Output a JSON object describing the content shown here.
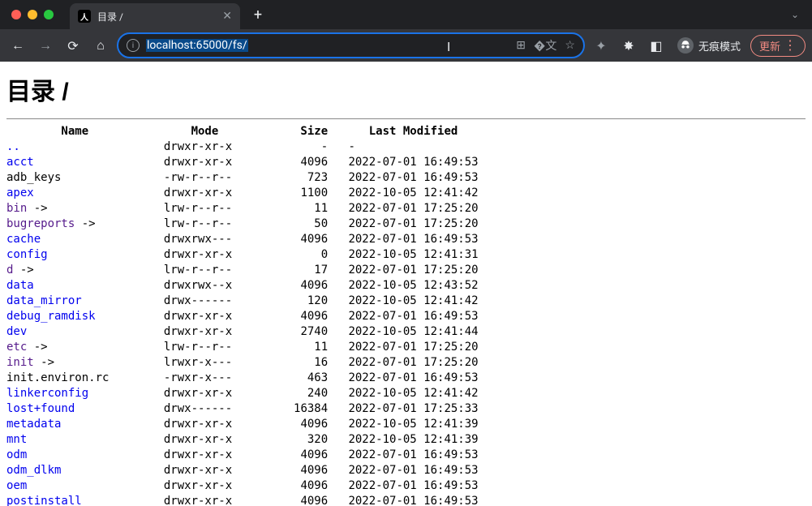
{
  "browser": {
    "tab_title": "目录 /",
    "url_display": "localhost:65000/fs/",
    "incognito_label": "无痕模式",
    "update_label": "更新"
  },
  "page": {
    "heading": "目录 /",
    "columns": {
      "name": "Name",
      "mode": "Mode",
      "size": "Size",
      "modified": "Last Modified"
    },
    "entries": [
      {
        "name": "..",
        "link": true,
        "visited": false,
        "arrow": false,
        "mode": "drwxr-xr-x",
        "size": "-",
        "modified": "-"
      },
      {
        "name": "acct",
        "link": true,
        "visited": false,
        "arrow": false,
        "mode": "drwxr-xr-x",
        "size": "4096",
        "modified": "2022-07-01 16:49:53"
      },
      {
        "name": "adb_keys",
        "link": false,
        "visited": false,
        "arrow": false,
        "mode": "-rw-r--r--",
        "size": "723",
        "modified": "2022-07-01 16:49:53"
      },
      {
        "name": "apex",
        "link": true,
        "visited": false,
        "arrow": false,
        "mode": "drwxr-xr-x",
        "size": "1100",
        "modified": "2022-10-05 12:41:42"
      },
      {
        "name": "bin",
        "link": true,
        "visited": true,
        "arrow": true,
        "mode": "lrw-r--r--",
        "size": "11",
        "modified": "2022-07-01 17:25:20"
      },
      {
        "name": "bugreports",
        "link": true,
        "visited": true,
        "arrow": true,
        "mode": "lrw-r--r--",
        "size": "50",
        "modified": "2022-07-01 17:25:20"
      },
      {
        "name": "cache",
        "link": true,
        "visited": false,
        "arrow": false,
        "mode": "drwxrwx---",
        "size": "4096",
        "modified": "2022-07-01 16:49:53"
      },
      {
        "name": "config",
        "link": true,
        "visited": false,
        "arrow": false,
        "mode": "drwxr-xr-x",
        "size": "0",
        "modified": "2022-10-05 12:41:31"
      },
      {
        "name": "d",
        "link": true,
        "visited": true,
        "arrow": true,
        "mode": "lrw-r--r--",
        "size": "17",
        "modified": "2022-07-01 17:25:20"
      },
      {
        "name": "data",
        "link": true,
        "visited": false,
        "arrow": false,
        "mode": "drwxrwx--x",
        "size": "4096",
        "modified": "2022-10-05 12:43:52"
      },
      {
        "name": "data_mirror",
        "link": true,
        "visited": false,
        "arrow": false,
        "mode": "drwx------",
        "size": "120",
        "modified": "2022-10-05 12:41:42"
      },
      {
        "name": "debug_ramdisk",
        "link": true,
        "visited": false,
        "arrow": false,
        "mode": "drwxr-xr-x",
        "size": "4096",
        "modified": "2022-07-01 16:49:53"
      },
      {
        "name": "dev",
        "link": true,
        "visited": false,
        "arrow": false,
        "mode": "drwxr-xr-x",
        "size": "2740",
        "modified": "2022-10-05 12:41:44"
      },
      {
        "name": "etc",
        "link": true,
        "visited": true,
        "arrow": true,
        "mode": "lrw-r--r--",
        "size": "11",
        "modified": "2022-07-01 17:25:20"
      },
      {
        "name": "init",
        "link": true,
        "visited": true,
        "arrow": true,
        "mode": "lrwxr-x---",
        "size": "16",
        "modified": "2022-07-01 17:25:20"
      },
      {
        "name": "init.environ.rc",
        "link": false,
        "visited": false,
        "arrow": false,
        "mode": "-rwxr-x---",
        "size": "463",
        "modified": "2022-07-01 16:49:53"
      },
      {
        "name": "linkerconfig",
        "link": true,
        "visited": false,
        "arrow": false,
        "mode": "drwxr-xr-x",
        "size": "240",
        "modified": "2022-10-05 12:41:42"
      },
      {
        "name": "lost+found",
        "link": true,
        "visited": false,
        "arrow": false,
        "mode": "drwx------",
        "size": "16384",
        "modified": "2022-07-01 17:25:33"
      },
      {
        "name": "metadata",
        "link": true,
        "visited": false,
        "arrow": false,
        "mode": "drwxr-xr-x",
        "size": "4096",
        "modified": "2022-10-05 12:41:39"
      },
      {
        "name": "mnt",
        "link": true,
        "visited": false,
        "arrow": false,
        "mode": "drwxr-xr-x",
        "size": "320",
        "modified": "2022-10-05 12:41:39"
      },
      {
        "name": "odm",
        "link": true,
        "visited": false,
        "arrow": false,
        "mode": "drwxr-xr-x",
        "size": "4096",
        "modified": "2022-07-01 16:49:53"
      },
      {
        "name": "odm_dlkm",
        "link": true,
        "visited": false,
        "arrow": false,
        "mode": "drwxr-xr-x",
        "size": "4096",
        "modified": "2022-07-01 16:49:53"
      },
      {
        "name": "oem",
        "link": true,
        "visited": false,
        "arrow": false,
        "mode": "drwxr-xr-x",
        "size": "4096",
        "modified": "2022-07-01 16:49:53"
      },
      {
        "name": "postinstall",
        "link": true,
        "visited": false,
        "arrow": false,
        "mode": "drwxr-xr-x",
        "size": "4096",
        "modified": "2022-07-01 16:49:53"
      }
    ]
  }
}
